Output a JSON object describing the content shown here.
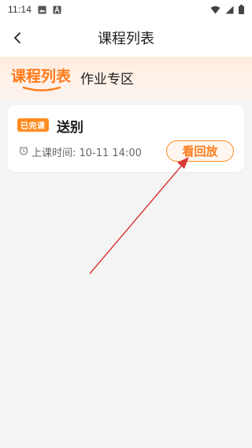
{
  "status_bar": {
    "time": "11:14",
    "left_icons": [
      "image-icon",
      "a-icon"
    ],
    "right_icons": [
      "wifi-icon",
      "signal-icon",
      "battery-icon"
    ]
  },
  "header": {
    "title": "课程列表",
    "back_icon": "chevron-left-icon"
  },
  "tabs": [
    {
      "label": "课程列表",
      "active": true
    },
    {
      "label": "作业专区",
      "active": false
    }
  ],
  "course_card": {
    "badge": "已完课",
    "title": "送别",
    "time_label": "上课时间: 10-11 14:00",
    "action_label": "看回放"
  },
  "colors": {
    "accent": "#ff7a1a",
    "annotation_arrow": "#d93a3a",
    "background": "#f4f4f4"
  }
}
